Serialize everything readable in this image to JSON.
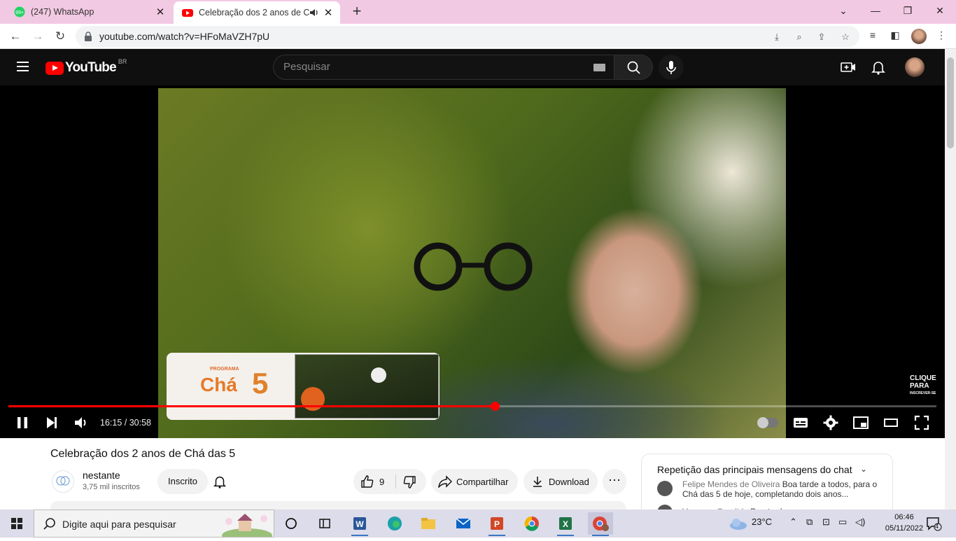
{
  "browser": {
    "tabs": [
      {
        "title": "(247) WhatsApp",
        "favicon": "whatsapp-icon",
        "badge": "99+",
        "active": false
      },
      {
        "title": "Celebração dos 2 anos de Chá das 5",
        "favicon": "youtube-icon",
        "active": true,
        "audio": true
      }
    ],
    "url": "youtube.com/watch?v=HFoMaVZH7pU"
  },
  "youtube": {
    "logo_text": "YouTube",
    "region": "BR",
    "search_placeholder": "Pesquisar"
  },
  "player": {
    "time": "16:15 / 30:58",
    "progress": 0.524,
    "overlay_program": "PROGRAMA",
    "overlay_cha": "Chá",
    "overlay_das": "DAS",
    "overlay_num": "5",
    "subscribe_badge_line1": "CLIQUE",
    "subscribe_badge_line2": "PARA",
    "subscribe_badge_line3": "INSCREVER-SE"
  },
  "video": {
    "title": "Celebração dos 2 anos de Chá das 5",
    "channel": "nestante",
    "subscribers": "3,75 mil inscritos",
    "subscribe_label": "Inscrito",
    "likes": "9",
    "share_label": "Compartilhar",
    "download_label": "Download"
  },
  "chat": {
    "header": "Repetição das principais mensagens do chat",
    "messages": [
      {
        "author": "Felipe Mendes de Oliveira",
        "text": "Boa tarde a todos, para o Chá das 5 de hoje, completando dois anos..."
      },
      {
        "author": "Vanessa Candido",
        "text": "Boa tarde"
      }
    ]
  },
  "taskbar": {
    "search_placeholder": "Digite aqui para pesquisar",
    "weather": "23°C",
    "time": "06:46",
    "date": "05/11/2022",
    "notifications": "4"
  },
  "colors": {
    "tab_strip": "#f2c9e3",
    "youtube_red": "#ff0000",
    "youtube_dark": "#0f0f0f"
  }
}
